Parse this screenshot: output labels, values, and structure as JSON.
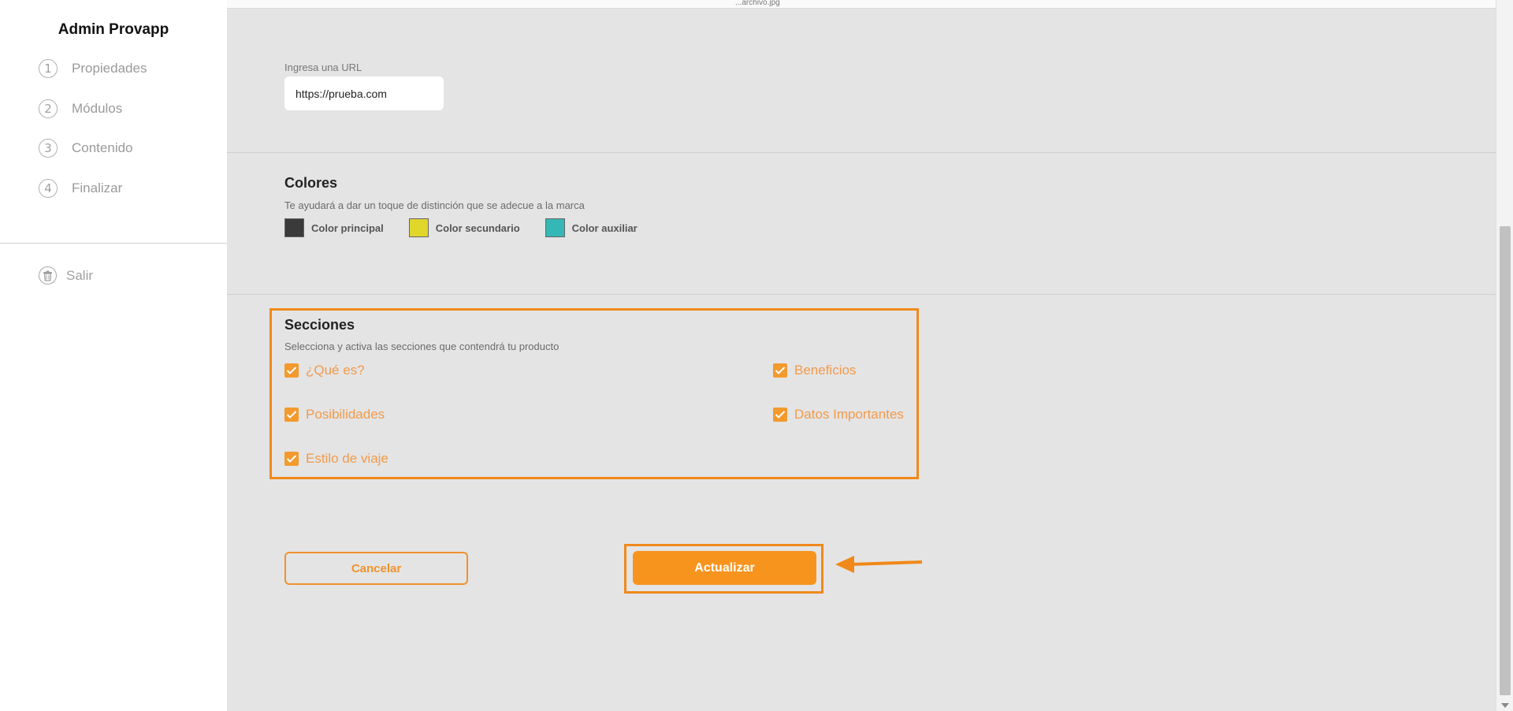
{
  "header": {
    "truncated_filename": "...archivo.jpg"
  },
  "sidebar": {
    "brand": "Admin Provapp",
    "items": [
      {
        "number": "1",
        "label": "Propiedades"
      },
      {
        "number": "2",
        "label": "Módulos"
      },
      {
        "number": "3",
        "label": "Contenido"
      },
      {
        "number": "4",
        "label": "Finalizar"
      }
    ],
    "logout_label": "Salir"
  },
  "url_section": {
    "label": "Ingresa una URL",
    "value": "https://prueba.com"
  },
  "colors_section": {
    "title": "Colores",
    "subtitle": "Te ayudará a dar un toque de distinción que se adecue a la marca",
    "swatches": [
      {
        "label": "Color principal",
        "color": "#3a3a3a"
      },
      {
        "label": "Color secundario",
        "color": "#e0d62c"
      },
      {
        "label": "Color auxiliar",
        "color": "#35b8b5"
      }
    ]
  },
  "sections_section": {
    "title": "Secciones",
    "subtitle": "Selecciona y activa las secciones que contendrá tu producto",
    "items": [
      {
        "label": "¿Qué es?",
        "checked": true
      },
      {
        "label": "Beneficios",
        "checked": true
      },
      {
        "label": "Posibilidades",
        "checked": true
      },
      {
        "label": "Datos Importantes",
        "checked": true
      },
      {
        "label": "Estilo de viaje",
        "checked": true
      }
    ]
  },
  "actions": {
    "cancel_label": "Cancelar",
    "update_label": "Actualizar"
  },
  "colors": {
    "accent": "#f7941d",
    "highlight": "#f0891a"
  }
}
